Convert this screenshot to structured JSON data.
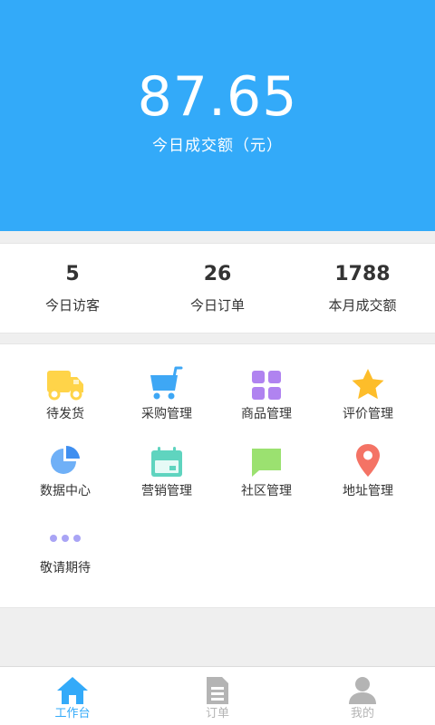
{
  "header": {
    "amount": "87.65",
    "amount_label": "今日成交额（元）"
  },
  "stats": [
    {
      "value": "5",
      "label": "今日访客"
    },
    {
      "value": "26",
      "label": "今日订单"
    },
    {
      "value": "1788",
      "label": "本月成交额"
    }
  ],
  "menu": [
    {
      "label": "待发货",
      "icon": "truck-icon",
      "color": "#ffd449"
    },
    {
      "label": "采购管理",
      "icon": "cart-icon",
      "color": "#3ea7f5"
    },
    {
      "label": "商品管理",
      "icon": "grid-icon",
      "color": "#b083f0"
    },
    {
      "label": "评价管理",
      "icon": "star-icon",
      "color": "#fdbd2a"
    },
    {
      "label": "数据中心",
      "icon": "pie-chart-icon",
      "color": "#6fb0f7"
    },
    {
      "label": "营销管理",
      "icon": "calendar-icon",
      "color": "#5fd4bf"
    },
    {
      "label": "社区管理",
      "icon": "chat-bubble-icon",
      "color": "#9be170"
    },
    {
      "label": "地址管理",
      "icon": "location-pin-icon",
      "color": "#f47365"
    },
    {
      "label": "敬请期待",
      "icon": "more-dots-icon",
      "color": "#a9a4f5"
    }
  ],
  "tabs": [
    {
      "label": "工作台",
      "icon": "home-icon",
      "active": true
    },
    {
      "label": "订单",
      "icon": "document-icon",
      "active": false
    },
    {
      "label": "我的",
      "icon": "user-icon",
      "active": false
    }
  ],
  "colors": {
    "primary": "#33aaf9",
    "inactive": "#b4b4b4"
  }
}
